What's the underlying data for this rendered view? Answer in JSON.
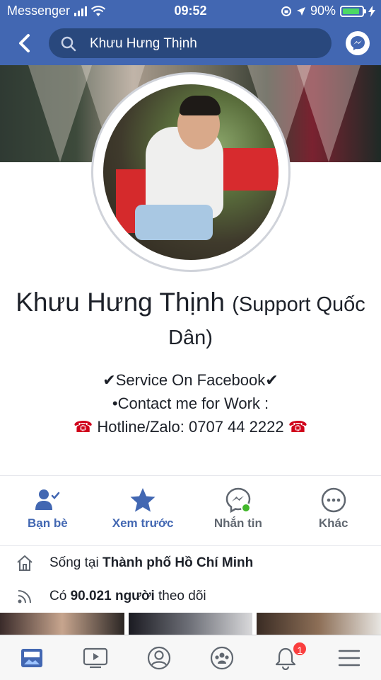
{
  "status_bar": {
    "carrier": "Messenger",
    "time": "09:52",
    "battery": "90%",
    "battery_level": 0.9
  },
  "nav": {
    "search_value": "Khưu Hưng Thịnh"
  },
  "profile": {
    "name": "Khưu Hưng Thịnh",
    "subtitle_line1": "(Support Quốc",
    "subtitle_line2": "Dân)",
    "bio": {
      "line1": "✔Service On Facebook✔",
      "line2": "•Contact me for Work :",
      "phone_icon": "☎",
      "line3": "Hotline/Zalo: 0707 44 2222"
    }
  },
  "actions": [
    {
      "label": "Bạn bè",
      "icon": "friends-check-icon",
      "color": "#4267b2"
    },
    {
      "label": "Xem trước",
      "icon": "star-icon",
      "color": "#4267b2"
    },
    {
      "label": "Nhắn tin",
      "icon": "messenger-icon",
      "color": "#606770"
    },
    {
      "label": "Khác",
      "icon": "more-icon",
      "color": "#606770"
    }
  ],
  "info": {
    "lives_prefix": "Sống tại",
    "lives_city": "Thành phố Hồ Chí Minh",
    "followers_prefix": "Có",
    "followers_count": "90.021 người",
    "followers_suffix": "theo dõi"
  },
  "tabbar": {
    "tabs": [
      "news-feed-icon",
      "watch-icon",
      "profile-icon",
      "groups-icon",
      "notifications-icon",
      "menu-icon"
    ],
    "notification_badge": "1"
  },
  "colors": {
    "brand": "#4267b2",
    "search_bg": "#29487d",
    "badge": "#fa3e3e",
    "phone_red": "#d0021b"
  }
}
